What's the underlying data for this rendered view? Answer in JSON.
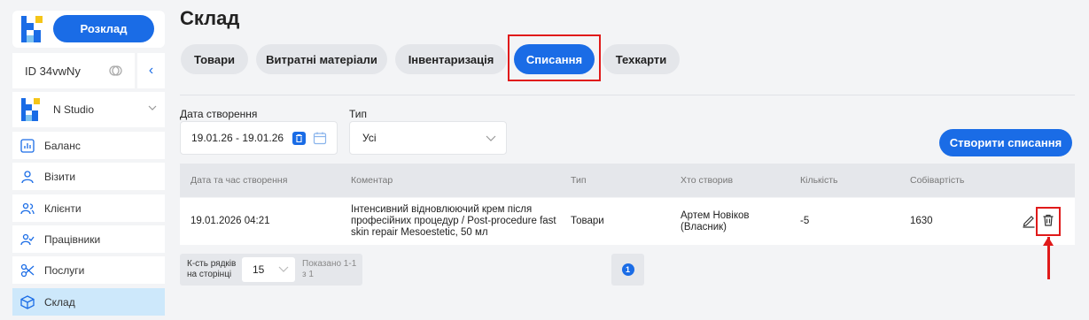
{
  "sidebar": {
    "schedule_label": "Розклад",
    "account_id": "ID 34vwNy",
    "studio_name": "N Studio",
    "items": [
      {
        "label": "Баланс",
        "icon": "chart-icon"
      },
      {
        "label": "Візити",
        "icon": "user-icon"
      },
      {
        "label": "Клієнти",
        "icon": "users-icon"
      },
      {
        "label": "Працівники",
        "icon": "user-check-icon"
      },
      {
        "label": "Послуги",
        "icon": "scissors-icon"
      },
      {
        "label": "Склад",
        "icon": "box-icon",
        "active": true
      }
    ]
  },
  "page": {
    "title": "Склад",
    "tabs": [
      {
        "label": "Товари"
      },
      {
        "label": "Витратні матеріали"
      },
      {
        "label": "Інвентаризація"
      },
      {
        "label": "Списання",
        "active": true
      },
      {
        "label": "Техкарти"
      }
    ]
  },
  "filters": {
    "date_label": "Дата створення",
    "date_value": "19.01.26 - 19.01.26",
    "type_label": "Тип",
    "type_value": "Усі",
    "create_button": "Створити списання"
  },
  "table": {
    "headers": [
      "Дата та час створення",
      "Коментар",
      "Тип",
      "Хто створив",
      "Кількість",
      "Собівартість"
    ],
    "rows": [
      {
        "datetime": "19.01.2026 04:21",
        "comment": "Інтенсивний відновлюючий крем після професійних процедур / Post-procedure fast skin repair Mesoestetic, 50 мл",
        "type": "Товари",
        "creator": "Артем Новіков (Власник)",
        "quantity": "-5",
        "cost": "1630"
      }
    ]
  },
  "pagination": {
    "rows_label": "К-сть рядків на сторінці",
    "rows_value": "15",
    "shown_label": "Показано 1-1 з 1",
    "current_page": "1"
  },
  "colors": {
    "accent": "#1a6ce6",
    "highlight": "#e01a1a",
    "active_nav": "#cde8fb"
  }
}
